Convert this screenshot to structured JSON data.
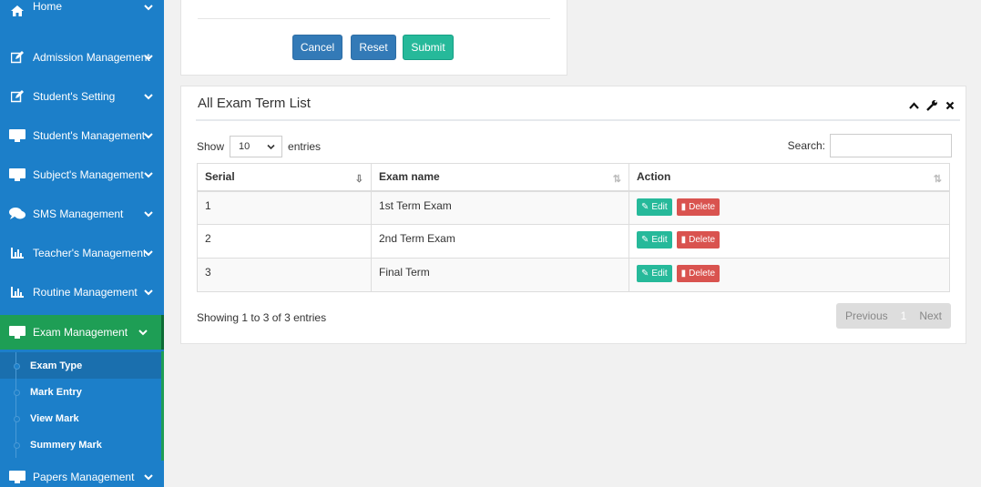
{
  "sidebar": {
    "items": [
      {
        "label": "Home",
        "icon": "home-icon"
      },
      {
        "label": "Admission Management",
        "icon": "edit-icon"
      },
      {
        "label": "Student's Setting",
        "icon": "edit-icon"
      },
      {
        "label": "Student's Management",
        "icon": "desktop-icon"
      },
      {
        "label": "Subject's Management",
        "icon": "desktop-icon"
      },
      {
        "label": "SMS Management",
        "icon": "comments-icon"
      },
      {
        "label": "Teacher's Management",
        "icon": "bar-chart-icon"
      },
      {
        "label": "Routine Management",
        "icon": "bar-chart-icon"
      },
      {
        "label": "Exam Management",
        "icon": "desktop-icon"
      },
      {
        "label": "Papers Management",
        "icon": "desktop-icon"
      }
    ],
    "exam_submenu": [
      "Exam Type",
      "Mark Entry",
      "View Mark",
      "Summery Mark"
    ]
  },
  "form": {
    "cancel_label": "Cancel",
    "reset_label": "Reset",
    "submit_label": "Submit"
  },
  "list_panel": {
    "title": "All Exam Term List",
    "show_label": "Show",
    "entries_value": "10",
    "entries_label": "entries",
    "search_label": "Search:",
    "search_value": "",
    "columns": [
      "Serial",
      "Exam name",
      "Action"
    ],
    "rows": [
      {
        "serial": "1",
        "name": "1st Term Exam"
      },
      {
        "serial": "2",
        "name": "2nd Term Exam"
      },
      {
        "serial": "3",
        "name": "Final Term"
      }
    ],
    "edit_label": "Edit",
    "delete_label": "Delete",
    "info": "Showing 1 to 3 of 3 entries",
    "pager": {
      "previous": "Previous",
      "page": "1",
      "next": "Next"
    }
  },
  "colors": {
    "sidebar": "#1c7fc9",
    "active": "#1e9e55",
    "primary_button": "#337ab7",
    "success_button": "#26b99a",
    "danger_button": "#d9534f"
  }
}
